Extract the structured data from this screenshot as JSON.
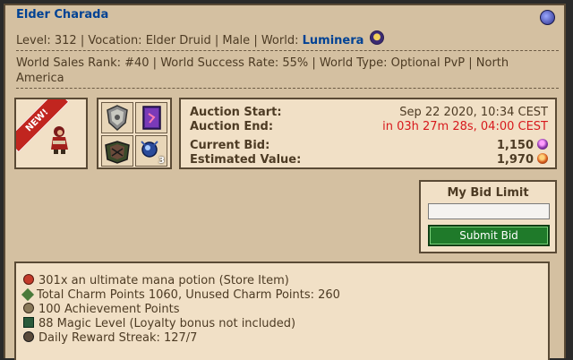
{
  "character": {
    "name": "Elder Charada",
    "level_label": "Level:",
    "level": "312",
    "vocation_label": "Vocation:",
    "vocation": "Elder Druid",
    "sex": "Male",
    "world_label": "World:",
    "world": "Luminera"
  },
  "world_info": {
    "text": "World Sales Rank: #40 | World Success Rate: 55% | World Type: Optional PvP | North America"
  },
  "badge": "NEW!",
  "item_slots": [
    {
      "icon": "shield-item-icon",
      "count": ""
    },
    {
      "icon": "spellbook-item-icon",
      "count": ""
    },
    {
      "icon": "mount-item-icon",
      "count": ""
    },
    {
      "icon": "enchanted-gem-icon",
      "count": "3"
    }
  ],
  "auction": {
    "start_label": "Auction Start:",
    "start_value": "Sep 22 2020, 10:34 CEST",
    "end_label": "Auction End:",
    "end_value": "in 03h 27m 28s, 04:00 CEST",
    "bid_label": "Current Bid:",
    "bid_value": "1,150",
    "est_label": "Estimated Value:",
    "est_value": "1,970"
  },
  "bid_form": {
    "title": "My Bid Limit",
    "input_value": "",
    "submit_label": "Submit Bid"
  },
  "features": [
    {
      "icon": "potion-icon",
      "text": "301x an ultimate mana potion (Store Item)"
    },
    {
      "icon": "charm-icon",
      "text": "Total Charm Points 1060, Unused Charm Points: 260"
    },
    {
      "icon": "achievement-icon",
      "text": "100 Achievement Points"
    },
    {
      "icon": "magic-level-icon",
      "text": "88 Magic Level (Loyalty bonus not included)"
    },
    {
      "icon": "reward-streak-icon",
      "text": "Daily Reward Streak: 127/7"
    }
  ],
  "colors": {
    "panel_bg": "#d4c0a1",
    "link": "#004294",
    "end_time": "#d7191d",
    "submit_button": "#1f7a2a"
  }
}
